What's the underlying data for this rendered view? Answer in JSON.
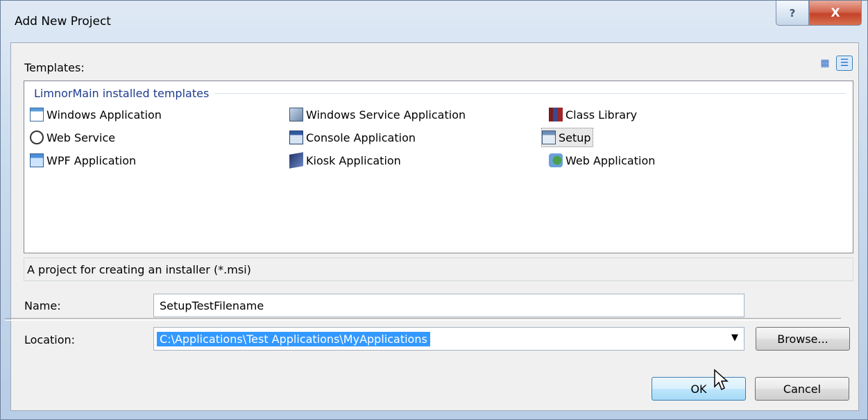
{
  "window": {
    "title": "Add New Project",
    "help_glyph": "?",
    "close_glyph": "X"
  },
  "templates": {
    "label": "Templates:",
    "group_header": "LimnorMain installed templates",
    "items": [
      {
        "label": "Windows Application",
        "icon": "windows-application-icon"
      },
      {
        "label": "Windows Service Application",
        "icon": "windows-service-icon"
      },
      {
        "label": "Class Library",
        "icon": "class-library-icon"
      },
      {
        "label": "Web Service",
        "icon": "web-service-icon"
      },
      {
        "label": "Console Application",
        "icon": "console-application-icon"
      },
      {
        "label": "Setup",
        "icon": "setup-icon",
        "selected": true
      },
      {
        "label": "WPF Application",
        "icon": "wpf-application-icon"
      },
      {
        "label": "Kiosk Application",
        "icon": "kiosk-application-icon"
      },
      {
        "label": "Web Application",
        "icon": "web-application-icon"
      }
    ]
  },
  "description": "A project for creating an installer (*.msi)",
  "form": {
    "name_label": "Name:",
    "name_value": "SetupTestFilename",
    "location_label": "Location:",
    "location_value": "C:\\Applications\\Test Applications\\MyApplications",
    "browse_label": "Browse..."
  },
  "buttons": {
    "ok": "OK",
    "cancel": "Cancel"
  }
}
